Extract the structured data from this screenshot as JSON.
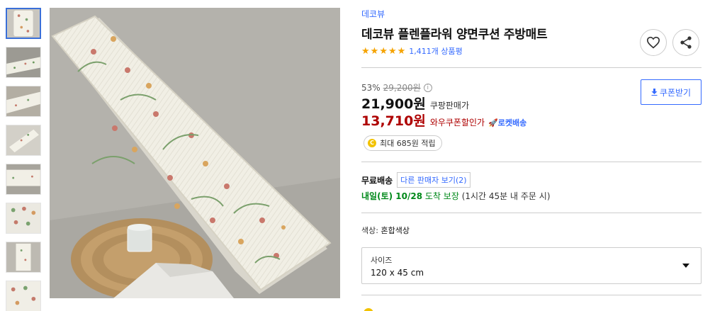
{
  "product": {
    "brand": "데코뷰",
    "title": "데코뷰 플렌플라워 양면쿠션 주방매트",
    "rating": 5,
    "review_count": "1,411개 상품평"
  },
  "pricing": {
    "discount_rate": "53%",
    "original_price": "29,200원",
    "info_mark": "i",
    "sale_price": "21,900원",
    "sale_label": "쿠팡판매가",
    "wow_price": "13,710원",
    "wow_label": "와우쿠폰할인가",
    "rocket_label": "🚀로켓배송",
    "coupon_button": "쿠폰받기",
    "points": "최대 685원 적립",
    "coin_mark": "C"
  },
  "shipping": {
    "free_label": "무료배송",
    "other_sellers": "다른 판매자 보기(2)",
    "arrive_date": "내일(토) 10/28",
    "arrive_text": "도착 보장",
    "arrive_note": "(1시간 45분 내 주문 시)"
  },
  "options": {
    "color_label": "색상:",
    "color_value": "혼합색상",
    "size_label": "사이즈",
    "size_value": "120 x 45 cm"
  },
  "gallery": {
    "thumbnail_count": 8,
    "active_index": 0
  },
  "colors": {
    "link_blue": "#346aff",
    "wow_red": "#ae0000",
    "delivery_green": "#00891a",
    "star": "#f5a300"
  },
  "icons": [
    "heart-icon",
    "share-icon",
    "download-icon",
    "info-icon",
    "coin-icon",
    "chevron-down-icon"
  ]
}
